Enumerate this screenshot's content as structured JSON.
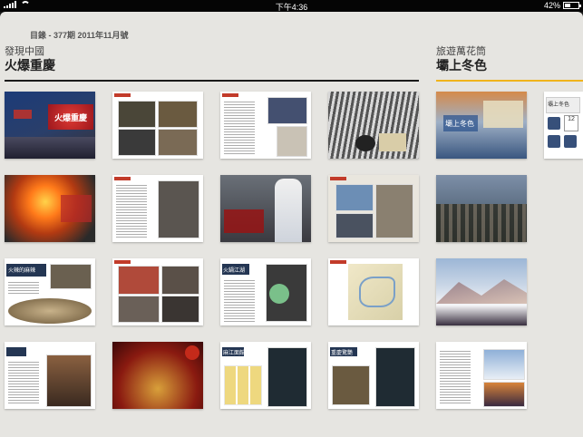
{
  "status_bar": {
    "carrier_signal": "signal",
    "time": "下午4:36",
    "battery_percent": "42%",
    "battery_level": 0.42
  },
  "toc": {
    "header": "目錄 - 377期 2011年11月號"
  },
  "sections": [
    {
      "subtitle": "發現中國",
      "title": "火爆重慶",
      "accent": "#1a1a1a"
    },
    {
      "subtitle": "旅遊萬花筒",
      "title": "壩上冬色",
      "accent": "#f0b41c"
    }
  ],
  "thumb_texts": {
    "t0_caption": "火爆重慶",
    "t8_caption": "火辣的麻辣",
    "t12_caption": "火鍋江湖",
    "t14_caption": "麻江面館",
    "t15_caption": "重慶驚艷",
    "r0_caption": "壩上冬色",
    "r1_caption": "壩上冬色",
    "r1_numbers": "12"
  },
  "colors": {
    "app_bg": "#e6e5e1",
    "tag_red": "#c23b2a",
    "accent_yellow": "#f0b41c"
  }
}
